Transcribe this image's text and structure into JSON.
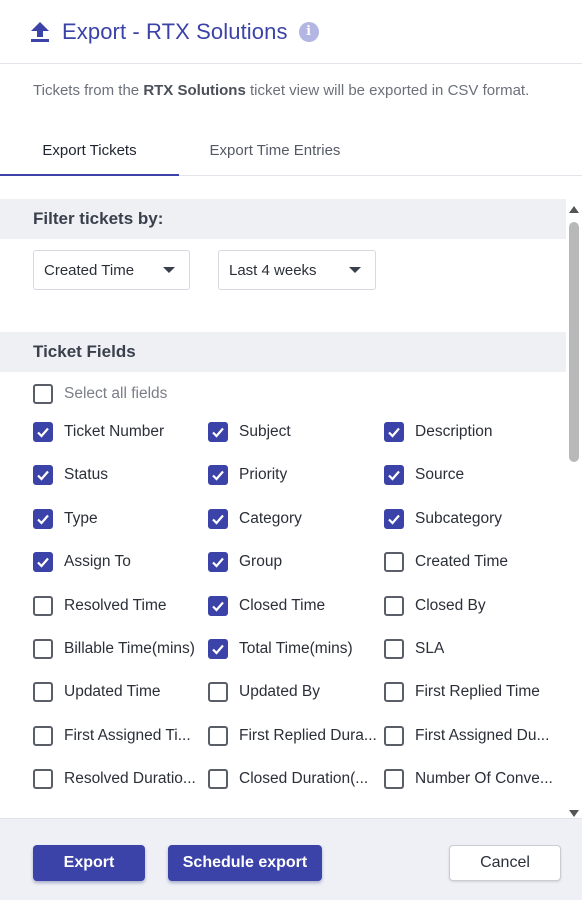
{
  "header": {
    "title": "Export - RTX Solutions",
    "icon": "upload-icon",
    "info_icon": "info-icon",
    "info_glyph": "i"
  },
  "description": {
    "prefix": "Tickets from the ",
    "view_name": "RTX Solutions",
    "suffix": " ticket view will be exported in CSV format."
  },
  "tabs": [
    {
      "label": "Export Tickets",
      "active": true
    },
    {
      "label": "Export Time Entries",
      "active": false
    }
  ],
  "filter": {
    "heading": "Filter tickets by:",
    "field_select": "Created Time",
    "range_select": "Last 4 weeks"
  },
  "ticket_fields": {
    "heading": "Ticket Fields",
    "select_all": {
      "label": "Select all fields",
      "checked": false
    },
    "fields": [
      {
        "label": "Ticket Number",
        "checked": true
      },
      {
        "label": "Subject",
        "checked": true
      },
      {
        "label": "Description",
        "checked": true
      },
      {
        "label": "Status",
        "checked": true
      },
      {
        "label": "Priority",
        "checked": true
      },
      {
        "label": "Source",
        "checked": true
      },
      {
        "label": "Type",
        "checked": true
      },
      {
        "label": "Category",
        "checked": true
      },
      {
        "label": "Subcategory",
        "checked": true
      },
      {
        "label": "Assign To",
        "checked": true
      },
      {
        "label": "Group",
        "checked": true
      },
      {
        "label": "Created Time",
        "checked": false
      },
      {
        "label": "Resolved Time",
        "checked": false
      },
      {
        "label": "Closed Time",
        "checked": true
      },
      {
        "label": "Closed By",
        "checked": false
      },
      {
        "label": "Billable Time(mins)",
        "checked": false
      },
      {
        "label": "Total Time(mins)",
        "checked": true
      },
      {
        "label": "SLA",
        "checked": false
      },
      {
        "label": "Updated Time",
        "checked": false
      },
      {
        "label": "Updated By",
        "checked": false
      },
      {
        "label": "First Replied Time",
        "checked": false
      },
      {
        "label": "First Assigned Ti...",
        "checked": false
      },
      {
        "label": "First Replied Dura...",
        "checked": false
      },
      {
        "label": "First Assigned Du...",
        "checked": false
      },
      {
        "label": "Resolved Duratio...",
        "checked": false
      },
      {
        "label": "Closed Duration(...",
        "checked": false
      },
      {
        "label": "Number Of Conve...",
        "checked": false
      }
    ]
  },
  "footer": {
    "export_label": "Export",
    "schedule_label": "Schedule export",
    "cancel_label": "Cancel"
  },
  "colors": {
    "accent": "#3b43a8",
    "section_bg": "#eef0f4",
    "footer_bg": "#eef0f6"
  }
}
